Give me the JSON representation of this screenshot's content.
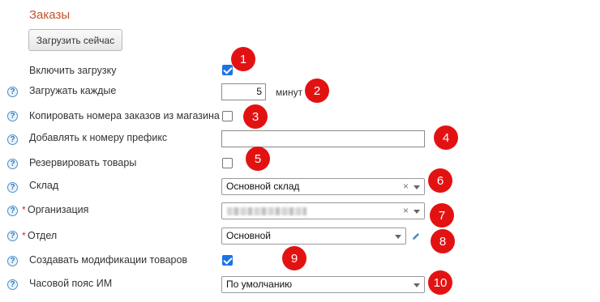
{
  "section_title": "Заказы",
  "load_now_button": "Загрузить сейчас",
  "help_glyph": "?",
  "required_mark": "*",
  "fields": {
    "enable_load": {
      "label": "Включить загрузку",
      "checked": true
    },
    "load_every": {
      "label": "Загружать каждые",
      "value": "5",
      "unit": "минут"
    },
    "copy_numbers": {
      "label": "Копировать номера заказов из магазина",
      "checked": false
    },
    "prefix": {
      "label": "Добавлять к номеру префикс",
      "value": ""
    },
    "reserve": {
      "label": "Резервировать товары",
      "checked": false
    },
    "warehouse": {
      "label": "Склад",
      "value": "Основной склад"
    },
    "organization": {
      "label": "Организация",
      "value": "",
      "obscured": true
    },
    "department": {
      "label": "Отдел",
      "value": "Основной"
    },
    "create_mods": {
      "label": "Создавать модификации товаров",
      "checked": true
    },
    "timezone": {
      "label": "Часовой пояс ИМ",
      "value": "По умолчанию"
    }
  },
  "clear_glyph": "×",
  "badges": [
    "1",
    "2",
    "3",
    "4",
    "5",
    "6",
    "7",
    "8",
    "9",
    "10"
  ],
  "icons": [
    "help-icon",
    "clear-icon",
    "dropdown-arrow-icon",
    "pencil-icon"
  ],
  "colors": {
    "title": "#c0552a",
    "badge": "#e31212",
    "checkbox": "#1a73e8",
    "help": "#2f7bbf"
  }
}
